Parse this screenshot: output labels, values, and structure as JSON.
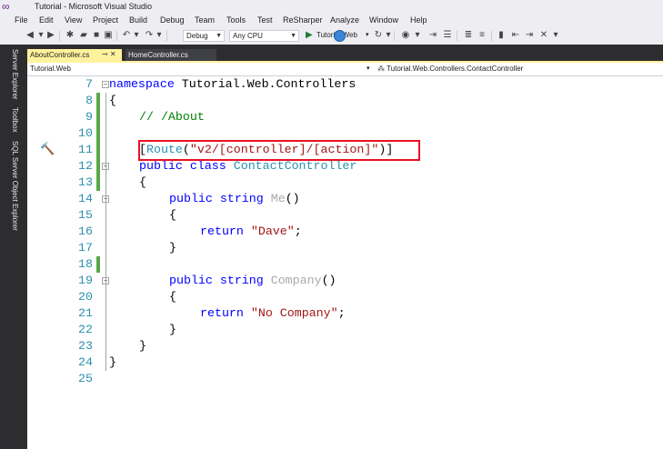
{
  "window": {
    "title": "Tutorial - Microsoft Visual Studio"
  },
  "menu": [
    "File",
    "Edit",
    "View",
    "Project",
    "Build",
    "Debug",
    "Team",
    "Tools",
    "Test",
    "ReSharper",
    "Analyze",
    "Window",
    "Help"
  ],
  "toolbar": {
    "configuration": "Debug",
    "platform": "Any CPU",
    "startup_project": "Tutorial.Web"
  },
  "side_tabs": [
    "Server Explorer",
    "Toolbox",
    "SQL Server Object Explorer"
  ],
  "tabs": [
    {
      "label": "AboutController.cs",
      "active": true
    },
    {
      "label": "HomeController.cs",
      "active": false
    }
  ],
  "navbar": {
    "project": "Tutorial.Web",
    "scope": "Tutorial.Web.Controllers.ContactController"
  },
  "code": {
    "line_numbers": [
      "7",
      "8",
      "9",
      "10",
      "11",
      "12",
      "13",
      "14",
      "15",
      "16",
      "17",
      "18",
      "19",
      "20",
      "21",
      "22",
      "23",
      "24",
      "25"
    ],
    "ns_kw": "namespace",
    "ns_name": " Tutorial.Web.Controllers",
    "open_brace": "{",
    "close_brace": "}",
    "comment": "// /About",
    "attr_open": "[",
    "attr_name": "Route",
    "attr_paren_open": "(",
    "attr_value": "\"v2/[controller]/[action]\"",
    "attr_close": ")]",
    "class_mods": "public class",
    "class_name": " ContactController",
    "method_mods": "public string",
    "method1": " Me",
    "method2": " Company",
    "parens": "()",
    "return_kw": "return",
    "ret1": " \"Dave\"",
    "ret2": " \"No Company\"",
    "semicolon": ";"
  },
  "colors": {
    "keyword": "#0000ff",
    "type": "#2b91af",
    "string": "#a31515",
    "comment": "#008000",
    "highlight_box": "#e81123",
    "active_tab": "#fff29d"
  }
}
